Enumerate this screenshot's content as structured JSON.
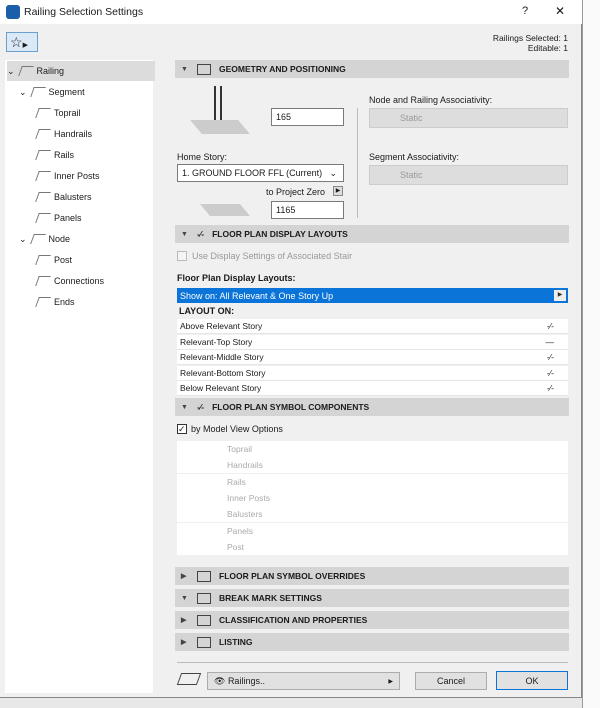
{
  "window": {
    "title": "Railing Selection Settings",
    "help": "?",
    "close": "✕"
  },
  "header": {
    "selected": "Railings Selected: 1",
    "editable": "Editable: 1"
  },
  "tree": [
    {
      "label": "Railing",
      "level": 0,
      "expanded": true
    },
    {
      "label": "Segment",
      "level": 1,
      "expanded": true
    },
    {
      "label": "Toprail",
      "level": 2
    },
    {
      "label": "Handrails",
      "level": 2
    },
    {
      "label": "Rails",
      "level": 2
    },
    {
      "label": "Inner Posts",
      "level": 2
    },
    {
      "label": "Balusters",
      "level": 2
    },
    {
      "label": "Panels",
      "level": 2
    },
    {
      "label": "Node",
      "level": 1,
      "expanded": true
    },
    {
      "label": "Post",
      "level": 2
    },
    {
      "label": "Connections",
      "level": 2
    },
    {
      "label": "Ends",
      "level": 2
    }
  ],
  "geometry": {
    "title": "GEOMETRY AND POSITIONING",
    "height": "165",
    "home_story_label": "Home Story:",
    "home_story": "1. GROUND FLOOR FFL (Current)",
    "to_project_zero": "to Project Zero",
    "offset": "1165",
    "node_assoc_label": "Node and Railing Associativity:",
    "node_assoc": "Static",
    "segment_assoc_label": "Segment Associativity:",
    "segment_assoc": "Static"
  },
  "layouts": {
    "title": "FLOOR PLAN DISPLAY LAYOUTS",
    "use_stair": "Use Display Settings of Associated Stair",
    "list_label": "Floor Plan Display Layouts:",
    "show_on": "Show on: All Relevant & One Story Up",
    "layout_on": "LAYOUT ON:",
    "rows": [
      "Above Relevant Story",
      "Relevant-Top Story",
      "Relevant-Middle Story",
      "Relevant-Bottom Story",
      "Below Relevant Story"
    ]
  },
  "symbol": {
    "title": "FLOOR PLAN SYMBOL COMPONENTS",
    "by_mvo": "by Model View Options",
    "items": [
      "Toprail",
      "Handrails",
      "Rails",
      "Inner Posts",
      "Balusters",
      "Panels",
      "Post"
    ]
  },
  "sections": [
    "FLOOR PLAN SYMBOL OVERRIDES",
    "BREAK MARK SETTINGS",
    "CLASSIFICATION AND PROPERTIES",
    "LISTING"
  ],
  "footer": {
    "layer": "Railings..",
    "cancel": "Cancel",
    "ok": "OK"
  }
}
